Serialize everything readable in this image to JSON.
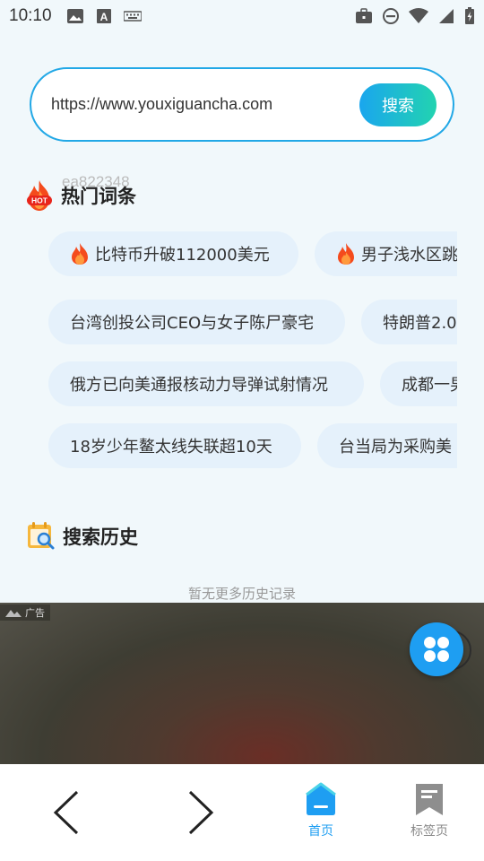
{
  "status_bar": {
    "time": "10:10",
    "left_icons": [
      "image-icon",
      "a-box-icon",
      "keyboard-icon"
    ],
    "right_icons": [
      "briefcase-icon",
      "dnd-icon",
      "wifi-icon",
      "signal-icon",
      "battery-icon"
    ]
  },
  "search": {
    "value": "https://www.youxiguancha.com",
    "button_label": "搜索"
  },
  "hot": {
    "title": "热门词条",
    "watermark": "ea822348",
    "rows": [
      [
        {
          "label": "比特币升破112000美元",
          "hot": true
        },
        {
          "label": "男子浅水区跳",
          "hot": true
        }
      ],
      [
        {
          "label": "台湾创投公司CEO与女子陈尸豪宅",
          "hot": false
        },
        {
          "label": "特朗普2.0",
          "hot": false
        }
      ],
      [
        {
          "label": "俄方已向美通报核动力导弹试射情况",
          "hot": false
        },
        {
          "label": "成都一男",
          "hot": false
        }
      ],
      [
        {
          "label": "18岁少年鳌太线失联超10天",
          "hot": false
        },
        {
          "label": "台当局为采购美",
          "hot": false
        }
      ]
    ]
  },
  "history": {
    "title": "搜索历史",
    "empty_text": "暂无更多历史记录"
  },
  "ad": {
    "label": "广告"
  },
  "bottom_nav": {
    "home_label": "首页",
    "bookmarks_label": "标签页"
  },
  "colors": {
    "accent": "#1e9ef2",
    "search_border": "#22a8e6",
    "chip_bg": "#e5f1fb",
    "page_bg": "#f1f8fb"
  }
}
